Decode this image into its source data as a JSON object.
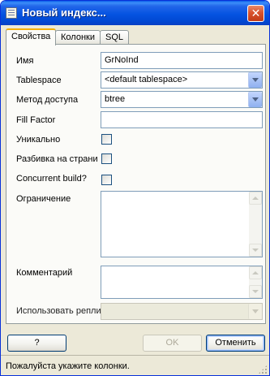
{
  "window": {
    "title": "Новый индекс...",
    "close_glyph": "✕"
  },
  "tabs": [
    {
      "label": "Свойства",
      "active": true
    },
    {
      "label": "Колонки",
      "active": false
    },
    {
      "label": "SQL",
      "active": false
    }
  ],
  "form": {
    "name_label": "Имя",
    "name_value": "GrNoInd",
    "tablespace_label": "Tablespace",
    "tablespace_value": "<default tablespace>",
    "access_method_label": "Метод доступа",
    "access_method_value": "btree",
    "fill_factor_label": "Fill Factor",
    "fill_factor_value": "",
    "unique_label": "Уникально",
    "unique_checked": false,
    "clustered_label": "Разбивка на страни",
    "clustered_checked": false,
    "concurrent_label": "Concurrent build?",
    "concurrent_checked": false,
    "constraint_label": "Ограничение",
    "constraint_value": "",
    "comment_label": "Комментарий",
    "comment_value": "",
    "replication_label": "Использовать репликацию",
    "replication_value": ""
  },
  "buttons": {
    "help_label": "?",
    "ok_label": "OK",
    "cancel_label": "Отменить"
  },
  "status": {
    "text": "Пожалуйста укажите колонки."
  },
  "colors": {
    "titlebar": "#0553e1",
    "dialog_bg": "#ece9d8",
    "active_tab_accent": "#f4b000",
    "combo_button": "#a9c3f5"
  }
}
